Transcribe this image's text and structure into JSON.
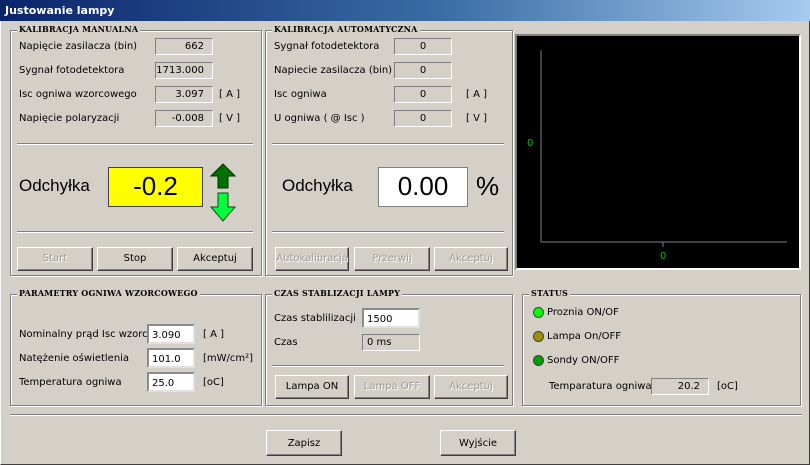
{
  "window": {
    "title": "Justowanie lampy"
  },
  "manual": {
    "title": "KALIBRACJA MANUALNA",
    "rows": [
      {
        "label": "Napięcie zasilacza (bin)",
        "value": "662",
        "unit": ""
      },
      {
        "label": "Sygnał fotodetektora",
        "value": "1713.000",
        "unit": ""
      },
      {
        "label": "Isc ogniwa wzorcowego",
        "value": "3.097",
        "unit": "[ A ]"
      },
      {
        "label": "Napięcie polaryzacji",
        "value": "-0.008",
        "unit": "[ V ]"
      }
    ],
    "deviation_label": "Odchyłka",
    "deviation_value": "-0.2",
    "buttons": {
      "start": "Start",
      "stop": "Stop",
      "accept": "Akceptuj"
    }
  },
  "auto": {
    "title": "KALIBRACJA AUTOMATYCZNA",
    "rows": [
      {
        "label": "Sygnał fotodetektora",
        "value": "0",
        "unit": ""
      },
      {
        "label": "Napiecie zasilacza (bin)",
        "value": "0",
        "unit": ""
      },
      {
        "label": "Isc ogniwa",
        "value": "0",
        "unit": "[ A ]"
      },
      {
        "label": "U ogniwa ( @  Isc )",
        "value": "0",
        "unit": "[ V ]"
      }
    ],
    "deviation_label": "Odchyłka",
    "deviation_value": "0.00",
    "deviation_unit": "%",
    "buttons": {
      "autocal": "Autokalibracja",
      "interrupt": "Przerwij",
      "accept": "Akceptuj"
    }
  },
  "plot": {
    "y_axis_label": "0",
    "x_axis_label": "0",
    "axis_color": "#808080",
    "label_color": "#00c000"
  },
  "reference_cell": {
    "title": "PARAMETRY OGNIWA WZORCOWEGO",
    "rows": [
      {
        "label": "Nominalny prąd Isc wzorca",
        "value": "3.090",
        "unit": "[ A ]"
      },
      {
        "label": "Natężenie oświetlenia",
        "value": "101.0",
        "unit": "[mW/cm²]"
      },
      {
        "label": "Temperatura ogniwa",
        "value": "25.0",
        "unit": "[oC]"
      }
    ]
  },
  "lamp_stabilization": {
    "title": "CZAS STABLIZACJI LAMPY",
    "stab_time_label": "Czas stablilizacji",
    "stab_time_value": "1500",
    "time_label": "Czas",
    "time_value": "0 ms",
    "buttons": {
      "lamp_on": "Lampa ON",
      "lamp_off": "Lampa OFF",
      "accept": "Akceptuj"
    }
  },
  "status": {
    "title": "STATUS",
    "items": [
      {
        "label": "Proznia ON/OF",
        "color": "#00ff00"
      },
      {
        "label": "Lampa On/OFF",
        "color": "#a09000"
      },
      {
        "label": "Sondy ON/OFF",
        "color": "#00a000"
      }
    ],
    "cell_temp_label": "Temparatura ogniwa",
    "cell_temp_value": "20.2",
    "cell_temp_unit": "[oC]"
  },
  "footer": {
    "save": "Zapisz",
    "exit": "Wyjście"
  }
}
